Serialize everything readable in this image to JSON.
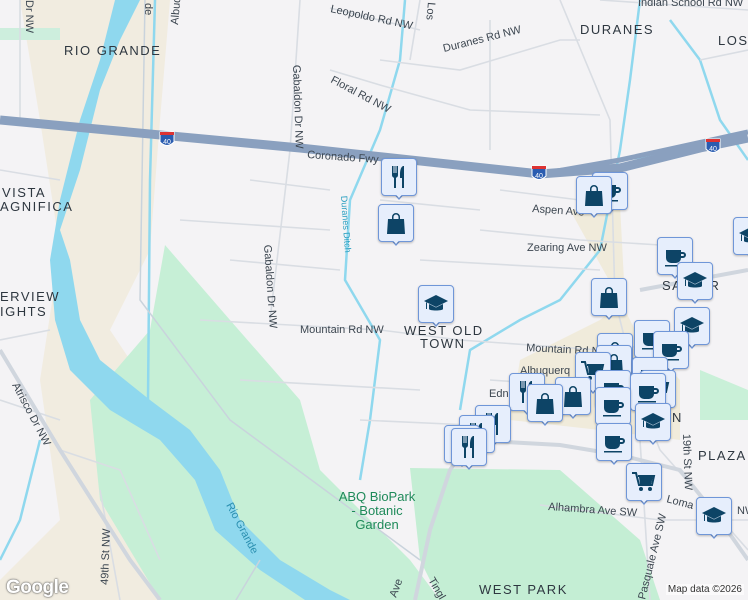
{
  "map": {
    "neighborhoods": {
      "rio_grande": "RIO GRANDE",
      "duranes": "DURANES",
      "los": "LOS",
      "vista": "VISTA",
      "magnifica": "AGNIFICA",
      "riverview": "ERVIEW",
      "heights": "IGHTS",
      "west_old_town_1": "WEST OLD",
      "west_old_town_2": "TOWN",
      "plaza": "PLAZA",
      "west_park": "WEST PARK",
      "sawmill": "SA    L AR",
      "n_frag": "N"
    },
    "streets": {
      "leopoldo": "Leopoldo Rd NW",
      "indian_school": "Indian School Rd NW",
      "duranes_rd": "Duranes Rd NW",
      "floral": "Floral Rd NW",
      "coronado": "Coronado Fwy",
      "gabaldon_1": "Gabaldon Dr NW",
      "gabaldon_2": "Gabaldon Dr NW",
      "aspen": "Aspen Ave",
      "zearing": "Zearing Ave NW",
      "mountain_1": "Mountain Rd NW",
      "mountain_2": "Mountain Rd N",
      "edna": "Edna",
      "atrisco": "Atrisco Dr NW",
      "st49": "49th St NW",
      "st19": "19th St NW",
      "alhambra": "Alhambra Ave SW",
      "pasquale": "Pasquale Ave SW",
      "lomas": "Loma",
      "lomas_nw": "NW",
      "tingley": "Tingl",
      "ave": "Ave",
      "los_frag": "Los",
      "albuq_frag": "Albuq",
      "de_frag": "de",
      "dr_nw_frag": "Dr NW"
    },
    "water": {
      "rio_grande_river": "Rio Grande",
      "duranes_ditch": "Duranes Ditch"
    },
    "poi": {
      "biopark_1": "ABQ BioPark",
      "biopark_2": "- Botanic",
      "biopark_3": "Garden",
      "albuquerque": "Albuquerq"
    },
    "highway_shield": "40",
    "attribution": "Map data ©2026",
    "logo": "Google"
  },
  "colors": {
    "marker_fill": "#e6eefc",
    "marker_border": "#6f96d8",
    "marker_icon": "#0d4466",
    "freeway": "#8aa0bf",
    "river": "#8fd8ee",
    "park": "#c4eed4"
  }
}
